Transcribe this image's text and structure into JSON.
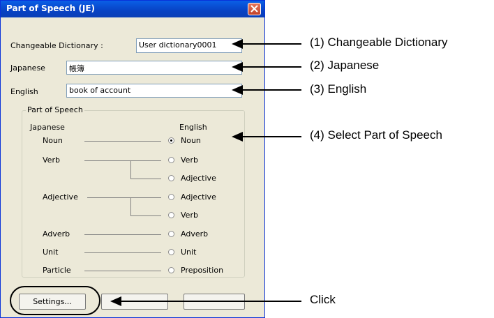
{
  "dialog": {
    "title": "Part of Speech (JE)",
    "changeable_label": "Changeable Dictionary :",
    "changeable_value": "User dictionary0001",
    "japanese_label": "Japanese",
    "japanese_value": "帳簿",
    "english_label": "English",
    "english_value": "book of account",
    "group_title": "Part of Speech",
    "col_japanese": "Japanese",
    "col_english": "English",
    "rows": [
      {
        "jp": "Noun",
        "en": "Noun",
        "selected": true
      },
      {
        "jp": "Verb",
        "en": "Verb",
        "selected": false
      },
      {
        "jp": "",
        "en": "Adjective",
        "selected": false
      },
      {
        "jp": "Adjective",
        "en": "Adjective",
        "selected": false
      },
      {
        "jp": "",
        "en": "Verb",
        "selected": false
      },
      {
        "jp": "Adverb",
        "en": "Adverb",
        "selected": false
      },
      {
        "jp": "Unit",
        "en": "Unit",
        "selected": false
      },
      {
        "jp": "Particle",
        "en": "Preposition",
        "selected": false
      }
    ],
    "settings_button": "Settings..."
  },
  "callouts": [
    "(1) Changeable Dictionary",
    "(2) Japanese",
    "(3) English",
    "(4) Select Part of Speech",
    "Click"
  ]
}
